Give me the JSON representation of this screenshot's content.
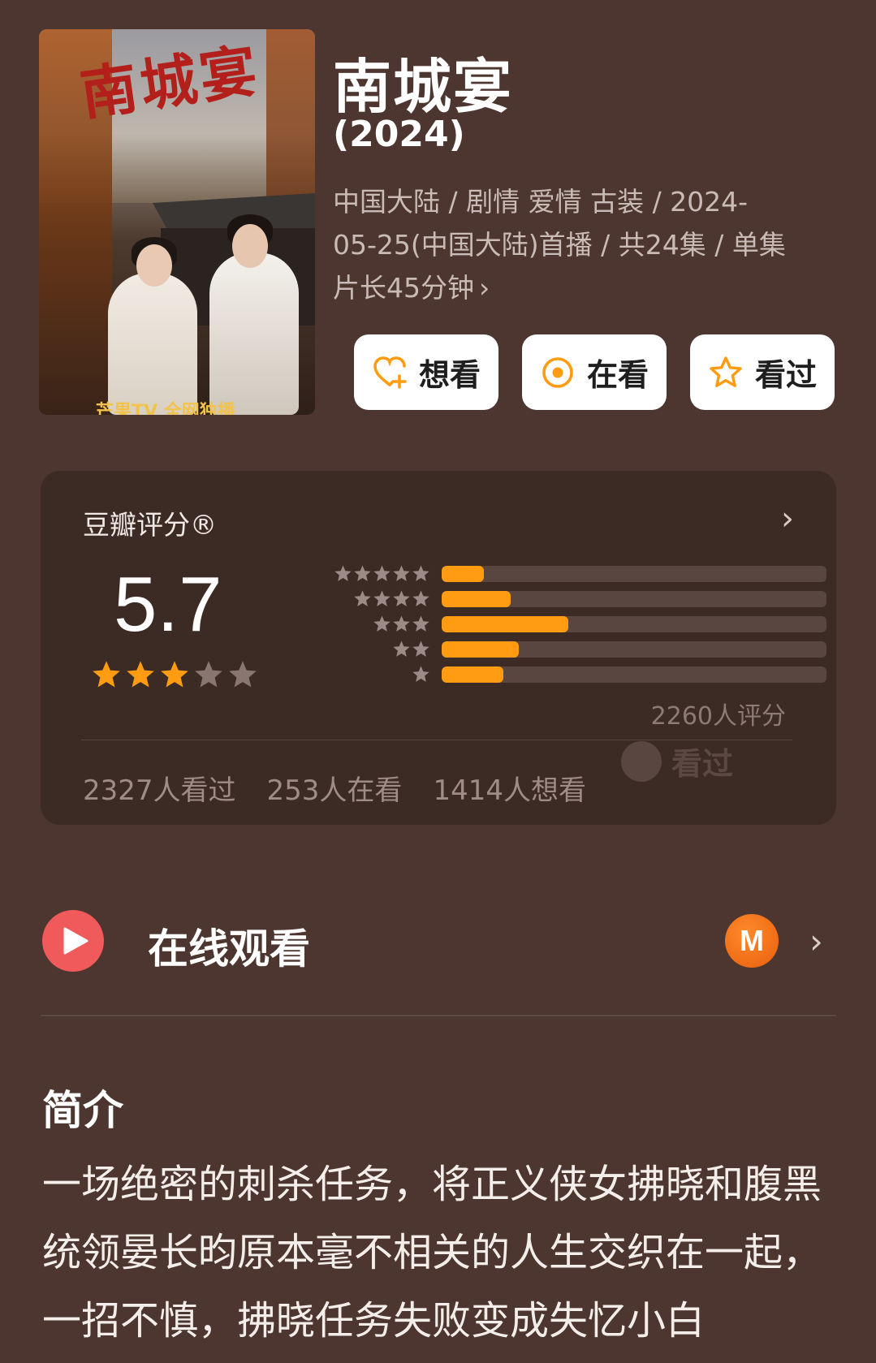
{
  "poster": {
    "title_art": "南城宴",
    "bottom_text": "芒果TV 全网独播"
  },
  "title": "南城宴",
  "year": "(2024)",
  "meta": "中国大陆 / 剧情 爱情 古装 / 2024-05-25(中国大陆)首播 / 共24集 / 单集片长45分钟",
  "meta_chevron": "›",
  "buttons": [
    {
      "label": "想看",
      "icon": "heart-plus-icon"
    },
    {
      "label": "在看",
      "icon": "target-icon"
    },
    {
      "label": "看过",
      "icon": "star-outline-icon"
    }
  ],
  "rating": {
    "title": "豆瓣评分®",
    "chevron": "›",
    "score": "5.7",
    "stars_filled": 3,
    "stars_total": 5,
    "distribution": [
      {
        "stars": 5,
        "fraction": 0.11
      },
      {
        "stars": 4,
        "fraction": 0.18
      },
      {
        "stars": 3,
        "fraction": 0.33
      },
      {
        "stars": 2,
        "fraction": 0.2
      },
      {
        "stars": 1,
        "fraction": 0.16
      }
    ],
    "count_text": "2260人评分",
    "seen_tag": "看过",
    "stats": [
      "2327人看过",
      "253人在看",
      "1414人想看"
    ]
  },
  "watch": {
    "label": "在线观看",
    "provider_icon": "mgtv-icon",
    "provider_glyph": "M",
    "chevron": "›"
  },
  "intro": {
    "title": "简介",
    "text": "一场绝密的刺杀任务，将正义侠女拂晓和腹黑统领晏长昀原本毫不相关的人生交织在一起，一招不慎，拂晓任务失败变成失忆小白"
  },
  "colors": {
    "background": "#4d3630",
    "card": "#3c2a24",
    "accent": "#ff9c12",
    "play": "#f05a5a"
  }
}
